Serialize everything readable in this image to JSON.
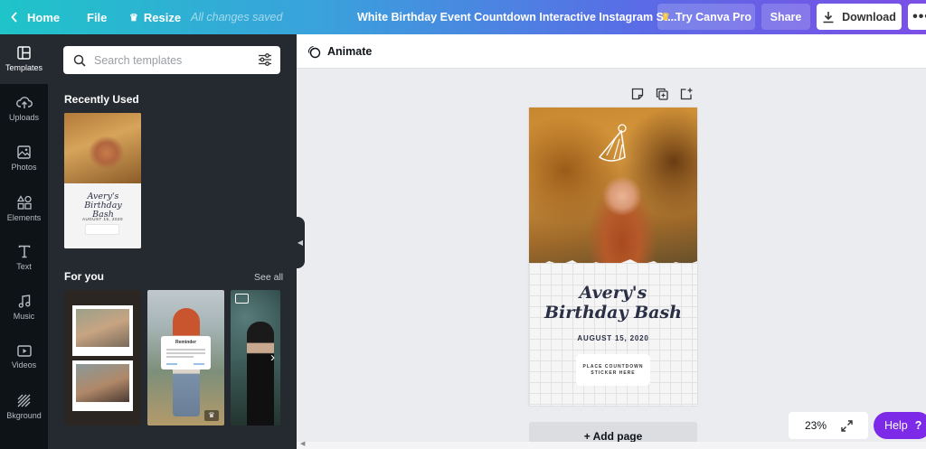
{
  "topbar": {
    "home": "Home",
    "file": "File",
    "resize": "Resize",
    "saved_status": "All changes saved",
    "title": "White Birthday Event Countdown Interactive Instagram St...",
    "try_pro": "Try Canva Pro",
    "share": "Share",
    "download": "Download",
    "more": "•••"
  },
  "nav": [
    {
      "label": "Templates",
      "icon": "templates-icon",
      "active": true
    },
    {
      "label": "Uploads",
      "icon": "upload-icon"
    },
    {
      "label": "Photos",
      "icon": "photo-icon"
    },
    {
      "label": "Elements",
      "icon": "elements-icon"
    },
    {
      "label": "Text",
      "icon": "text-icon"
    },
    {
      "label": "Music",
      "icon": "music-icon"
    },
    {
      "label": "Videos",
      "icon": "video-icon"
    },
    {
      "label": "Bkground",
      "icon": "background-icon"
    }
  ],
  "panel": {
    "search_placeholder": "Search templates",
    "recently_used": "Recently Used",
    "for_you": "For you",
    "see_all": "See all",
    "recent_thumb": {
      "title": "Avery's Birthday Bash",
      "date": "AUGUST 15, 2020"
    },
    "reminder_card": {
      "title": "Reminder"
    }
  },
  "canvas": {
    "animate": "Animate",
    "design": {
      "title_line1": "Avery's",
      "title_line2": "Birthday Bash",
      "date": "AUGUST 15, 2020",
      "sticker": "PLACE COUNTDOWN STICKER HERE"
    },
    "add_page": "+ Add page",
    "zoom": "23%"
  },
  "help": {
    "label": "Help",
    "q": "?"
  },
  "colors": {
    "accent_purple": "#7d2ae8",
    "dark_nav": "#0e1318",
    "panel": "#252a31"
  }
}
